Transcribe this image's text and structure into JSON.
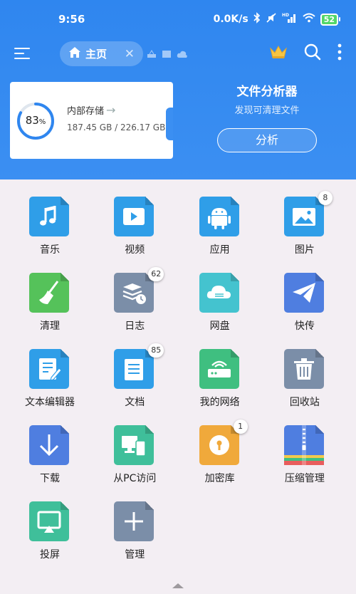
{
  "status_bar": {
    "time": "9:56",
    "net_speed": "0.0K/s",
    "network": "HD",
    "battery": "52"
  },
  "toolbar": {
    "home_tab_label": "主页",
    "close_glyph": "✕"
  },
  "storage": {
    "percent_text": "83",
    "percent_sign": "%",
    "used_fraction": 0.83,
    "title": "内部存储",
    "arrow": "→",
    "sizes": "187.45 GB / 226.17 GB"
  },
  "analyzer": {
    "title": "文件分析器",
    "subtitle": "发现可清理文件",
    "button_label": "分析"
  },
  "apps": [
    {
      "name": "音乐",
      "icon": "music-icon",
      "color": "#2f9ee8",
      "badge": ""
    },
    {
      "name": "视频",
      "icon": "video-icon",
      "color": "#2f9ee8",
      "badge": ""
    },
    {
      "name": "应用",
      "icon": "android-icon",
      "color": "#2f9ee8",
      "badge": ""
    },
    {
      "name": "图片",
      "icon": "image-icon",
      "color": "#2f9ee8",
      "badge": "8"
    },
    {
      "name": "清理",
      "icon": "broom-icon",
      "color": "#55c25a",
      "badge": ""
    },
    {
      "name": "日志",
      "icon": "log-icon",
      "color": "#7b8ea8",
      "badge": "62"
    },
    {
      "name": "网盘",
      "icon": "cloud-drive-icon",
      "color": "#44c3cf",
      "badge": ""
    },
    {
      "name": "快传",
      "icon": "paper-plane-icon",
      "color": "#4f7ee0",
      "badge": ""
    },
    {
      "name": "文本编辑器",
      "icon": "text-editor-icon",
      "color": "#2f9ee8",
      "badge": ""
    },
    {
      "name": "文档",
      "icon": "document-icon",
      "color": "#2f9ee8",
      "badge": "85"
    },
    {
      "name": "我的网络",
      "icon": "router-icon",
      "color": "#3fbf80",
      "badge": ""
    },
    {
      "name": "回收站",
      "icon": "trash-icon",
      "color": "#7b8ea8",
      "badge": ""
    },
    {
      "name": "下载",
      "icon": "download-icon",
      "color": "#4f7ee0",
      "badge": ""
    },
    {
      "name": "从PC访问",
      "icon": "pc-access-icon",
      "color": "#3fbf9a",
      "badge": ""
    },
    {
      "name": "加密库",
      "icon": "vault-icon",
      "color": "#f0a93b",
      "badge": "1"
    },
    {
      "name": "压缩管理",
      "icon": "archive-icon",
      "color": "#4f7ee0",
      "badge": ""
    },
    {
      "name": "投屏",
      "icon": "cast-screen-icon",
      "color": "#3fbf9a",
      "badge": ""
    },
    {
      "name": "管理",
      "icon": "add-icon",
      "color": "#7b8ea8",
      "badge": ""
    }
  ]
}
